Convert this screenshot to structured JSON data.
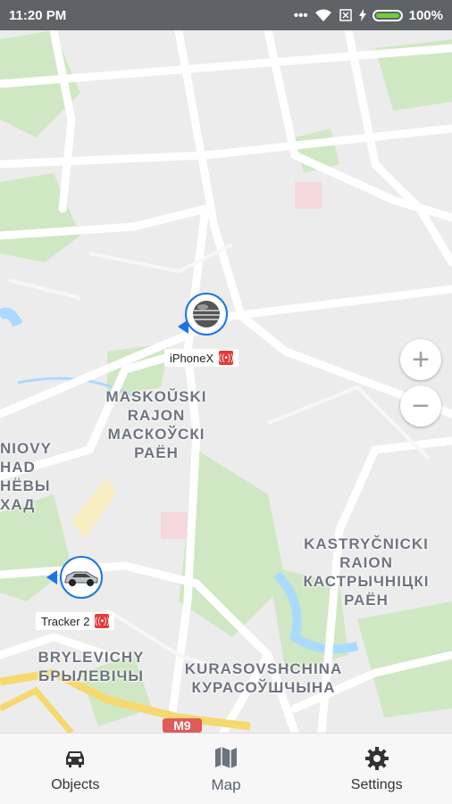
{
  "status_bar": {
    "time": "11:20 PM",
    "battery": "100%",
    "icons": [
      "dots-icon",
      "wifi-icon",
      "sim-off-icon",
      "charging-icon",
      "battery-icon"
    ]
  },
  "map": {
    "labels": {
      "maskouski": [
        "MASKOŬSKI",
        "RAJON",
        "МАСКОЎСКІ",
        "РАЁН"
      ],
      "kastrycnicki": [
        "KASTRYČNICKI",
        "RAION",
        "КАСТРЫЧНІЦКІ",
        "РАЁН"
      ],
      "brylevichy": [
        "BRYLEVICHY",
        "БРЫЛЕВІЧЫ"
      ],
      "kurasovshchina": [
        "KURASOVSHCHINA",
        "КУРАСОЎШЧЫНА"
      ],
      "niovy": [
        "NIOVY",
        "HAD",
        "НЁВЫ",
        "ХАД"
      ]
    },
    "road_shield": "M9"
  },
  "objects": [
    {
      "name": "iPhoneX",
      "icon": "sphere-icon",
      "online_icon": "signal-icon"
    },
    {
      "name": "Tracker 2",
      "icon": "car-icon",
      "online_icon": "signal-icon"
    }
  ],
  "zoom": {
    "in": "+",
    "out": "−"
  },
  "tabs": [
    {
      "label": "Objects",
      "icon": "car-icon"
    },
    {
      "label": "Map",
      "icon": "map-icon"
    },
    {
      "label": "Settings",
      "icon": "gear-icon"
    }
  ],
  "colors": {
    "accent": "#1b73e8",
    "status_bar": "#5f6368",
    "signal": "#e53935",
    "park": "#cfe8c3"
  }
}
